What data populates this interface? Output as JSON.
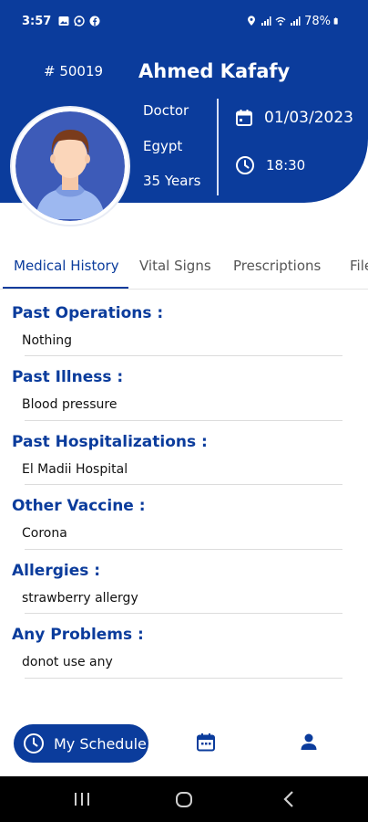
{
  "status_bar": {
    "time": "3:57",
    "battery": "78%",
    "left_icons": [
      "gallery-icon",
      "whatsapp-icon",
      "facebook-icon"
    ],
    "right_icons": [
      "location-icon",
      "signal-icon",
      "wifi-icon",
      "signal-icon",
      "battery-icon"
    ]
  },
  "patient": {
    "id": "# 50019",
    "name": "Ahmed Kafafy",
    "occupation": "Doctor",
    "country": "Egypt",
    "age": "35 Years",
    "date": "01/03/2023",
    "time": "18:30"
  },
  "tabs": [
    {
      "label": "Medical History",
      "active": true
    },
    {
      "label": "Vital Signs",
      "active": false
    },
    {
      "label": "Prescriptions",
      "active": false
    },
    {
      "label": "Files",
      "active": false
    }
  ],
  "history": [
    {
      "title": "Past Operations :",
      "value": "Nothing"
    },
    {
      "title": "Past Illness :",
      "value": "Blood pressure"
    },
    {
      "title": "Past Hospitalizations :",
      "value": "El Madii Hospital"
    },
    {
      "title": "Other Vaccine :",
      "value": "Corona"
    },
    {
      "title": "Allergies :",
      "value": "strawberry allergy"
    },
    {
      "title": "Any Problems :",
      "value": "donot use any"
    }
  ],
  "bottom_nav": {
    "schedule_label": "My Schedule",
    "icons": [
      "clock-icon",
      "calendar-icon",
      "person-icon"
    ]
  },
  "colors": {
    "primary": "#0b3c9c",
    "header_text": "#ffffff"
  }
}
